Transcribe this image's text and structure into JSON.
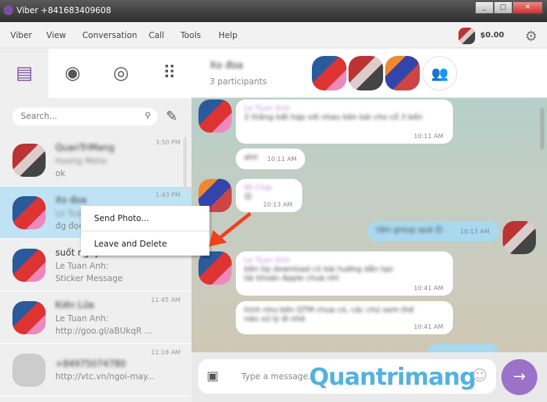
{
  "window": {
    "title": "Viber +841683409608",
    "min": "_",
    "max": "□",
    "close": "✕"
  },
  "menu": [
    "Viber",
    "View",
    "Conversation",
    "Call",
    "Tools",
    "Help"
  ],
  "balance": "$0.00",
  "search": {
    "placeholder": "Search..."
  },
  "conversations": [
    {
      "name": "QuanTriMang",
      "sender": "Huong Meta:",
      "text": "ok",
      "time": "3:50 PM"
    },
    {
      "name": "Xo đoa",
      "sender": "Le Tuan Anh:",
      "text": "đg đọc",
      "time": "1:43 PM"
    },
    {
      "name": "suốt ngày",
      "sender": "Le Tuan Anh:",
      "text": "Sticker Message",
      "time": ""
    },
    {
      "name": "Kiến Lửa",
      "sender": "Le Tuan Anh:",
      "text": "http://goo.gl/aBUkqR ...",
      "time": "11:45 AM"
    },
    {
      "name": "+84975074780",
      "sender": "",
      "text": "http://vtc.vn/ngoi-may...",
      "time": "11:18 AM"
    }
  ],
  "context_menu": [
    "Send Photo...",
    "Leave and Delete"
  ],
  "chat": {
    "name": "Xo đoa",
    "participants": "3 participants",
    "messages": [
      {
        "who": "Le Tuan Anh",
        "text": "2 thằng bất hợp với nhau bên bài cho cổ 3 bến",
        "time": "10:11 AM"
      },
      {
        "who": "",
        "text": "ahii",
        "time": "10:11 AM"
      },
      {
        "who": "Mi Chịp",
        "text": "😊",
        "time": "10:13 AM"
      },
      {
        "who": "",
        "text": "tấm group quá 😊",
        "time": "10:13 AM"
      },
      {
        "who": "Le Tuan Anh",
        "text": "bên tip download có bài hướng dẫn tạo tài khoản Apple chưa nhỉ",
        "time": "10:41 AM"
      },
      {
        "who": "",
        "text": "hình như bên QTM chưa có, các chú xem thế nào xử lý đi nhé",
        "time": "10:41 AM"
      }
    ]
  },
  "input": {
    "placeholder": "Type a message..."
  },
  "watermark": "Quantrimang"
}
